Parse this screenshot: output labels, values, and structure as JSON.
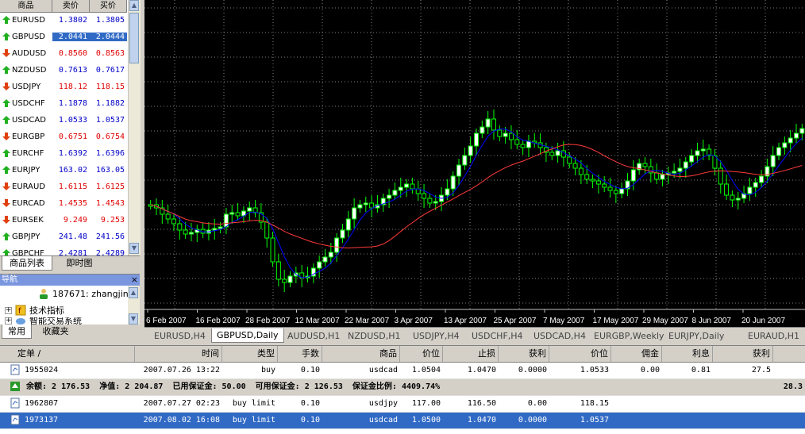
{
  "market_watch": {
    "headers": {
      "symbol": "商品",
      "bid": "卖价",
      "ask": "买价"
    },
    "rows": [
      {
        "symbol": "EURUSD",
        "bid": "1.3802",
        "ask": "1.3805",
        "dir": "up",
        "selected": false
      },
      {
        "symbol": "GBPUSD",
        "bid": "2.0441",
        "ask": "2.0444",
        "dir": "up",
        "selected": true
      },
      {
        "symbol": "AUDUSD",
        "bid": "0.8560",
        "ask": "0.8563",
        "dir": "down",
        "selected": false
      },
      {
        "symbol": "NZDUSD",
        "bid": "0.7613",
        "ask": "0.7617",
        "dir": "up",
        "selected": false
      },
      {
        "symbol": "USDJPY",
        "bid": "118.12",
        "ask": "118.15",
        "dir": "down",
        "selected": false
      },
      {
        "symbol": "USDCHF",
        "bid": "1.1878",
        "ask": "1.1882",
        "dir": "up",
        "selected": false
      },
      {
        "symbol": "USDCAD",
        "bid": "1.0533",
        "ask": "1.0537",
        "dir": "up",
        "selected": false
      },
      {
        "symbol": "EURGBP",
        "bid": "0.6751",
        "ask": "0.6754",
        "dir": "down",
        "selected": false
      },
      {
        "symbol": "EURCHF",
        "bid": "1.6392",
        "ask": "1.6396",
        "dir": "up",
        "selected": false
      },
      {
        "symbol": "EURJPY",
        "bid": "163.02",
        "ask": "163.05",
        "dir": "up",
        "selected": false
      },
      {
        "symbol": "EURAUD",
        "bid": "1.6115",
        "ask": "1.6125",
        "dir": "down",
        "selected": false
      },
      {
        "symbol": "EURCAD",
        "bid": "1.4535",
        "ask": "1.4543",
        "dir": "down",
        "selected": false
      },
      {
        "symbol": "EURSEK",
        "bid": "9.249",
        "ask": "9.253",
        "dir": "down",
        "selected": false
      },
      {
        "symbol": "GBPJPY",
        "bid": "241.48",
        "ask": "241.56",
        "dir": "up",
        "selected": false
      },
      {
        "symbol": "GBPCHF",
        "bid": "2.4281",
        "ask": "2.4289",
        "dir": "up",
        "selected": false
      }
    ],
    "tabs": [
      "商品列表",
      "即时图"
    ]
  },
  "navigator": {
    "title": "导航",
    "close": "×",
    "account": "187671: zhangjin",
    "items": [
      "技术指标",
      "智能交易系统"
    ],
    "tabs": [
      "常用",
      "收藏夹"
    ]
  },
  "chart_data": {
    "type": "candlestick",
    "symbol": "GBPUSD",
    "timeframe": "Daily",
    "x_labels": [
      "6 Feb 2007",
      "16 Feb 2007",
      "28 Feb 2007",
      "12 Mar 2007",
      "22 Mar 2007",
      "3 Apr 2007",
      "13 Apr 2007",
      "25 Apr 2007",
      "7 May 2007",
      "17 May 2007",
      "29 May 2007",
      "8 Jun 2007",
      "20 Jun 2007"
    ],
    "colors": {
      "background": "#000000",
      "bull": "#ffffff",
      "bear": "#000000",
      "wick": "#00ff00",
      "fast_ma": "#0000ff",
      "slow_ma": "#ff3a3a",
      "grid": "#808080"
    },
    "grid": true
  },
  "chart_tabs": [
    "EURUSD,H4",
    "GBPUSD,Daily",
    "AUDUSD,H1",
    "NZDUSD,H1",
    "USDJPY,H4",
    "USDCHF,H4",
    "USDCAD,H4",
    "EURGBP,Weekly",
    "EURJPY,Daily",
    "EURAUD,H1"
  ],
  "terminal": {
    "columns": [
      "定单 /",
      "时间",
      "类型",
      "手数",
      "商品",
      "价位",
      "止损",
      "获利",
      "价位",
      "佣金",
      "利息",
      "获利"
    ],
    "orders": [
      {
        "ticket": "1955024",
        "time": "2007.07.26 13:22",
        "type": "buy",
        "lots": "0.10",
        "symbol": "usdcad",
        "price": "1.0504",
        "sl": "1.0470",
        "tp": "0.0000",
        "cur": "1.0533",
        "commission": "0.00",
        "swap": "0.81",
        "profit": "27.5"
      },
      {
        "ticket": "1962807",
        "time": "2007.07.27 02:23",
        "type": "buy limit",
        "lots": "0.10",
        "symbol": "usdjpy",
        "price": "117.00",
        "sl": "116.50",
        "tp": "0.00",
        "cur": "118.15",
        "commission": "",
        "swap": "",
        "profit": ""
      },
      {
        "ticket": "1973137",
        "time": "2007.08.02 16:08",
        "type": "buy limit",
        "lots": "0.10",
        "symbol": "usdcad",
        "price": "1.0500",
        "sl": "1.0470",
        "tp": "0.0000",
        "cur": "1.0537",
        "commission": "",
        "swap": "",
        "profit": ""
      }
    ],
    "balance_line": "余额: 2 176.53  净值: 2 204.87  已用保证金: 50.00  可用保证金: 2 126.53  保证金比例: 4409.74%",
    "balance_profit": "28.3"
  }
}
